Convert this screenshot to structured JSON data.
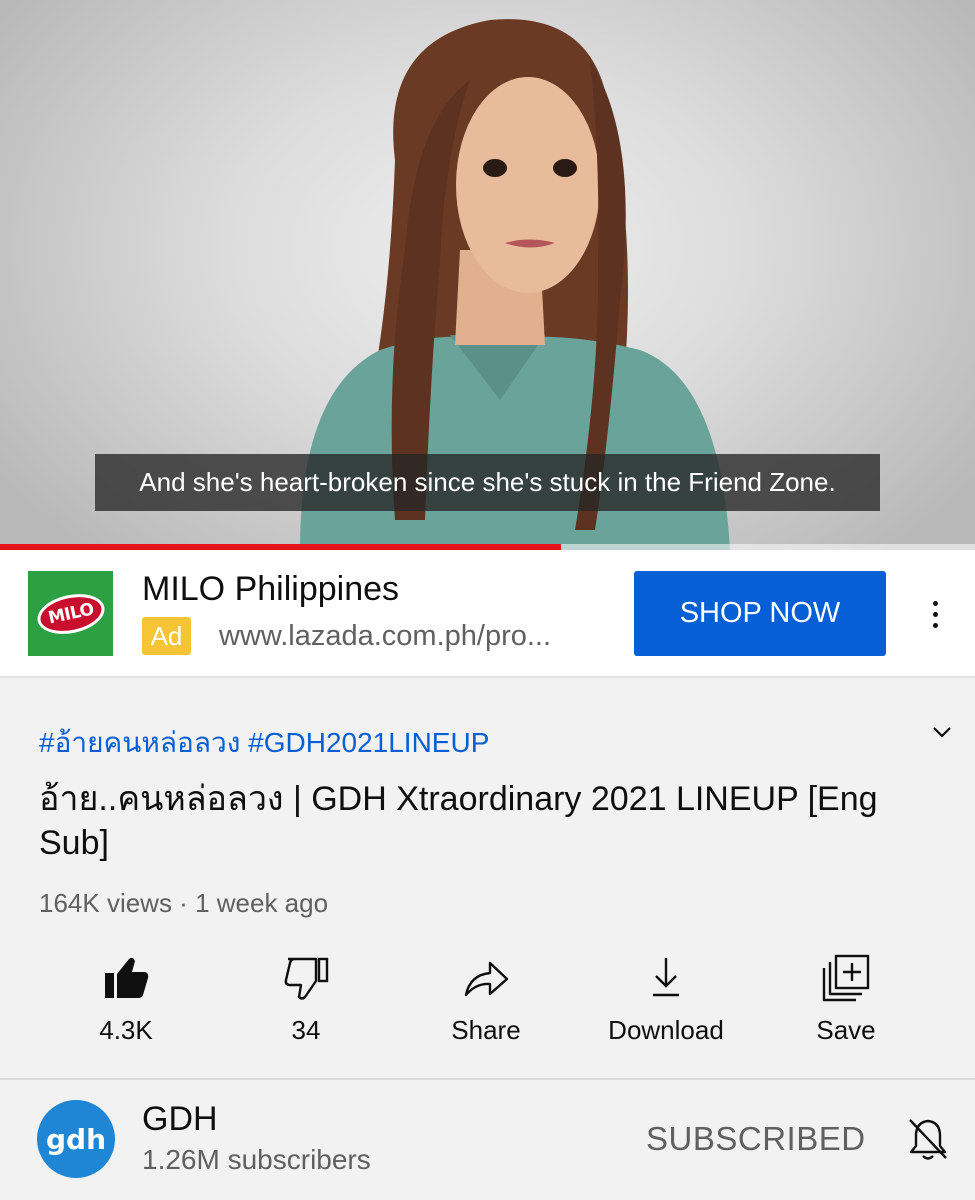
{
  "video": {
    "caption": "And she's heart-broken since she's stuck in the Friend Zone.",
    "progress": 0.575,
    "progress_color": "#e5131b"
  },
  "ad": {
    "logo_text": "MILO",
    "advertiser": "MILO Philippines",
    "badge": "Ad",
    "url": "www.lazada.com.ph/pro...",
    "cta": "SHOP NOW",
    "cta_color": "#065fd4"
  },
  "video_info": {
    "hashtags": "#อ้ายคนหล่อลวง #GDH2021LINEUP",
    "title": "อ้าย..คนหล่อลวง | GDH Xtraordinary 2021 LINEUP [Eng Sub]",
    "meta": "164K views · 1 week ago"
  },
  "actions": [
    {
      "icon": "thumbs-up-icon",
      "label": "4.3K"
    },
    {
      "icon": "thumbs-down-icon",
      "label": "34"
    },
    {
      "icon": "share-icon",
      "label": "Share"
    },
    {
      "icon": "download-icon",
      "label": "Download"
    },
    {
      "icon": "save-playlist-icon",
      "label": "Save"
    }
  ],
  "channel": {
    "avatar_text": "gdh",
    "name": "GDH",
    "subscribers": "1.26M subscribers",
    "subscribe_state": "SUBSCRIBED",
    "avatar_color": "#1f86d6"
  }
}
